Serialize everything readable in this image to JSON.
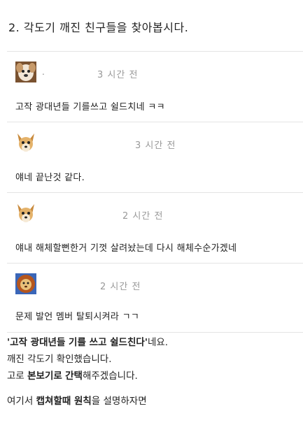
{
  "heading": "2. 각도기 깨진 친구들을 찾아봅시다.",
  "comments": [
    {
      "avatar": "dog-puppy-icon",
      "dot": ".",
      "time": "3 시간 전",
      "text": "고작 광대년들 기를쓰고 쉴드치네 ㅋㅋ"
    },
    {
      "avatar": "chihuahua-icon",
      "time": "3 시간 전",
      "text": "얘네 끝난것 같다."
    },
    {
      "avatar": "chihuahua-icon",
      "time": "2 시간 전",
      "text": "얘내 해체할뻔한거 기껏 살려놨는데 다시 해체수순가겠네"
    },
    {
      "avatar": "lion-icon",
      "time": "2 시간 전",
      "text": "문제 발언 멤버 탈퇴시켜라 ㄱㄱ"
    }
  ],
  "body": {
    "line1_quote_open": "'",
    "line1_bold": "고작 광대년들 기를 쓰고 쉴드친다",
    "line1_quote_close": "'",
    "line1_suffix": "네요.",
    "line2": "깨진 각도기 확인했습니다.",
    "line3_prefix": "고로 ",
    "line3_bold1": "본보기로",
    "line3_mid": " ",
    "line3_bold2": "간택",
    "line3_suffix": "해주겠습니다.",
    "line4_prefix": "여기서 ",
    "line4_bold": "캡쳐할때 원칙",
    "line4_suffix": "을 설명하자면"
  }
}
